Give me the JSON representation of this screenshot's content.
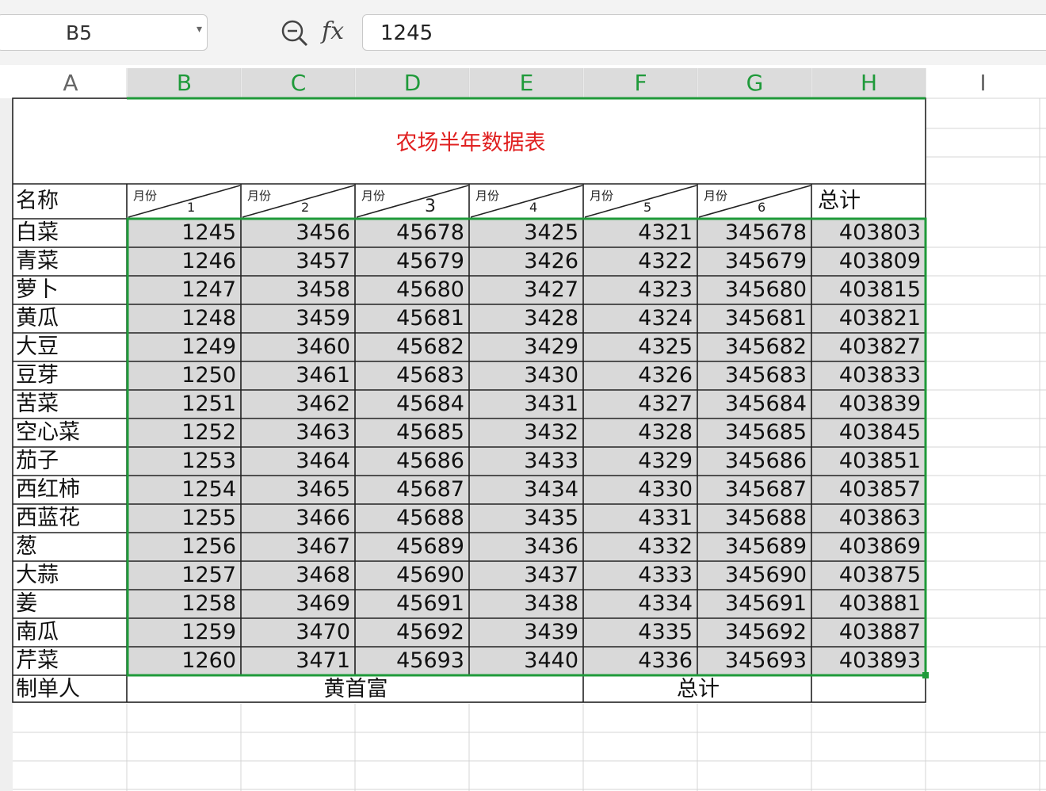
{
  "formula_bar": {
    "name_box": "B5",
    "fx_label": "fx",
    "value": "1245"
  },
  "columns": [
    "A",
    "B",
    "C",
    "D",
    "E",
    "F",
    "G",
    "H",
    "I"
  ],
  "table": {
    "title": "农场半年数据表",
    "name_header": "名称",
    "month_label": "月份",
    "months": [
      "1",
      "2",
      "3",
      "4",
      "5",
      "6"
    ],
    "total_header": "总计",
    "rows": [
      {
        "name": "白菜",
        "values": [
          "1245",
          "3456",
          "45678",
          "3425",
          "4321",
          "345678",
          "403803"
        ]
      },
      {
        "name": "青菜",
        "values": [
          "1246",
          "3457",
          "45679",
          "3426",
          "4322",
          "345679",
          "403809"
        ]
      },
      {
        "name": "萝卜",
        "values": [
          "1247",
          "3458",
          "45680",
          "3427",
          "4323",
          "345680",
          "403815"
        ]
      },
      {
        "name": "黄瓜",
        "values": [
          "1248",
          "3459",
          "45681",
          "3428",
          "4324",
          "345681",
          "403821"
        ]
      },
      {
        "name": "大豆",
        "values": [
          "1249",
          "3460",
          "45682",
          "3429",
          "4325",
          "345682",
          "403827"
        ]
      },
      {
        "name": "豆芽",
        "values": [
          "1250",
          "3461",
          "45683",
          "3430",
          "4326",
          "345683",
          "403833"
        ]
      },
      {
        "name": "苦菜",
        "values": [
          "1251",
          "3462",
          "45684",
          "3431",
          "4327",
          "345684",
          "403839"
        ]
      },
      {
        "name": "空心菜",
        "values": [
          "1252",
          "3463",
          "45685",
          "3432",
          "4328",
          "345685",
          "403845"
        ]
      },
      {
        "name": "茄子",
        "values": [
          "1253",
          "3464",
          "45686",
          "3433",
          "4329",
          "345686",
          "403851"
        ]
      },
      {
        "name": "西红柿",
        "values": [
          "1254",
          "3465",
          "45687",
          "3434",
          "4330",
          "345687",
          "403857"
        ]
      },
      {
        "name": "西蓝花",
        "values": [
          "1255",
          "3466",
          "45688",
          "3435",
          "4331",
          "345688",
          "403863"
        ]
      },
      {
        "name": "葱",
        "values": [
          "1256",
          "3467",
          "45689",
          "3436",
          "4332",
          "345689",
          "403869"
        ]
      },
      {
        "name": "大蒜",
        "values": [
          "1257",
          "3468",
          "45690",
          "3437",
          "4333",
          "345690",
          "403875"
        ]
      },
      {
        "name": "姜",
        "values": [
          "1258",
          "3469",
          "45691",
          "3438",
          "4334",
          "345691",
          "403881"
        ]
      },
      {
        "name": "南瓜",
        "values": [
          "1259",
          "3470",
          "45692",
          "3439",
          "4335",
          "345692",
          "403887"
        ]
      },
      {
        "name": "芹菜",
        "values": [
          "1260",
          "3471",
          "45693",
          "3440",
          "4336",
          "345693",
          "403893"
        ]
      }
    ],
    "footer": {
      "maker_label": "制单人",
      "maker_name": "黄首富",
      "total_label": "总计",
      "total_value": ""
    }
  },
  "colors": {
    "selection": "#1f9a3a",
    "title": "#e02020",
    "shade": "#d9d9d9"
  }
}
